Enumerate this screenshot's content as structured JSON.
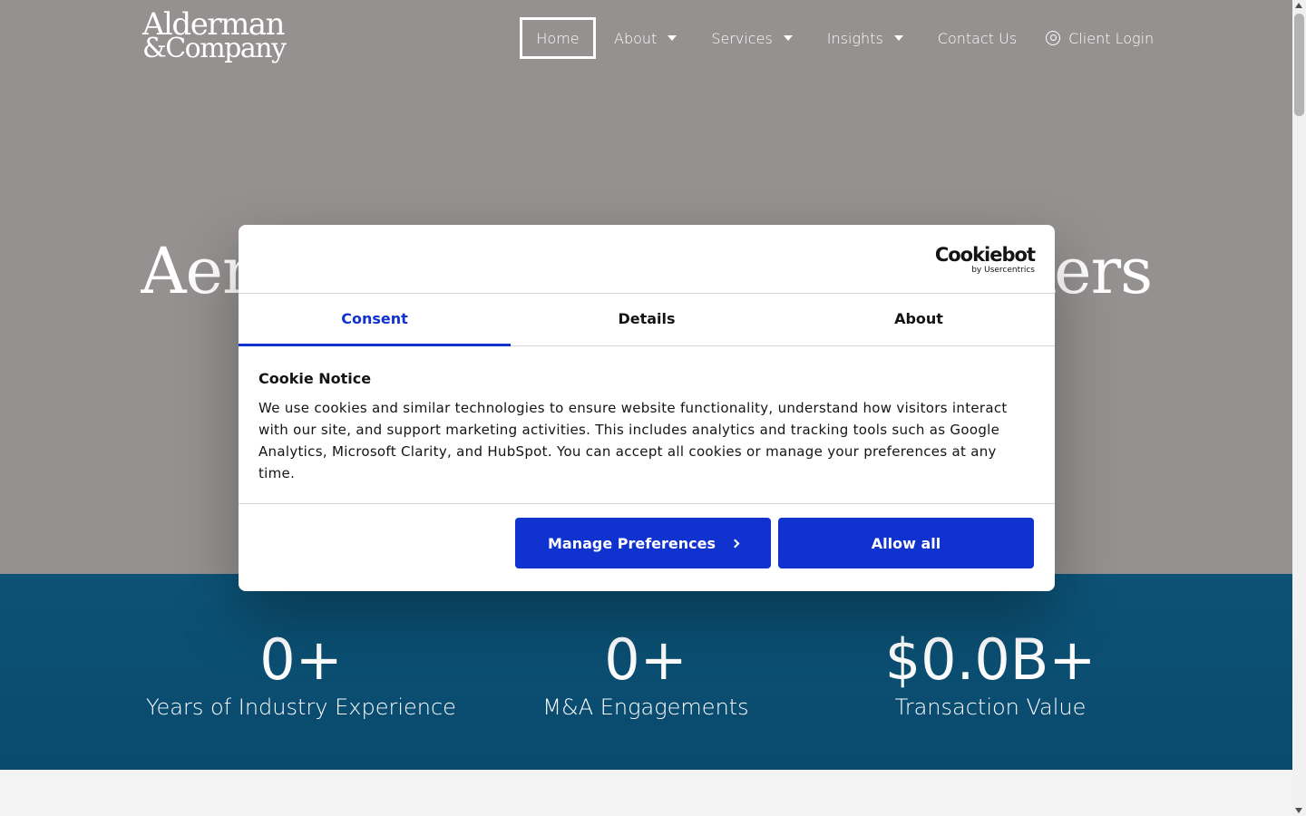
{
  "header": {
    "logo_line1": "Alderman",
    "logo_line2": "&Company",
    "nav": {
      "home": "Home",
      "about": "About",
      "services": "Services",
      "insights": "Insights",
      "contact": "Contact Us",
      "client_login": "Client Login"
    }
  },
  "hero": {
    "title_left": "Aer",
    "title_right": "kers"
  },
  "stats": [
    {
      "value": "0+",
      "label": "Years of Industry Experience"
    },
    {
      "value": "0+",
      "label": "M&A Engagements"
    },
    {
      "value": "$0.0B+",
      "label": "Transaction Value"
    }
  ],
  "cookie_modal": {
    "brand": "Cookiebot",
    "brand_sub": "by Usercentrics",
    "tabs": [
      "Consent",
      "Details",
      "About"
    ],
    "active_tab": "Consent",
    "notice_title": "Cookie Notice",
    "notice_text": "We use cookies and similar technologies to ensure website functionality, understand how visitors interact with our site, and support marketing activities. This includes analytics and tracking tools such as Google Analytics, Microsoft Clarity, and HubSpot. You can accept all cookies or manage your preferences at any time.",
    "manage_button": "Manage Preferences",
    "allow_button": "Allow all"
  },
  "colors": {
    "hero_bg": "#949190",
    "stats_bg": "#0b4f73",
    "accent": "#1032cf"
  }
}
